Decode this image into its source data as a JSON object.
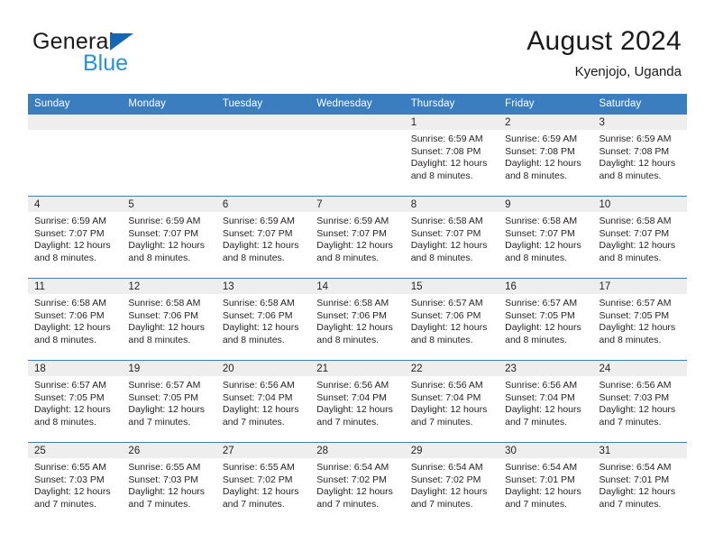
{
  "brand": {
    "name_top": "General",
    "name_bottom": "Blue",
    "flag_color": "#1667b2",
    "blue_text_color": "#2b8fd6"
  },
  "header": {
    "title": "August 2024",
    "subtitle": "Kyenjojo, Uganda",
    "accent_color": "#3a7ebf"
  },
  "weekday_headers": [
    "Sunday",
    "Monday",
    "Tuesday",
    "Wednesday",
    "Thursday",
    "Friday",
    "Saturday"
  ],
  "weeks": [
    [
      {
        "day": "",
        "empty": true
      },
      {
        "day": "",
        "empty": true
      },
      {
        "day": "",
        "empty": true
      },
      {
        "day": "",
        "empty": true
      },
      {
        "day": "1",
        "sunrise": "Sunrise: 6:59 AM",
        "sunset": "Sunset: 7:08 PM",
        "daylight1": "Daylight: 12 hours",
        "daylight2": "and 8 minutes."
      },
      {
        "day": "2",
        "sunrise": "Sunrise: 6:59 AM",
        "sunset": "Sunset: 7:08 PM",
        "daylight1": "Daylight: 12 hours",
        "daylight2": "and 8 minutes."
      },
      {
        "day": "3",
        "sunrise": "Sunrise: 6:59 AM",
        "sunset": "Sunset: 7:08 PM",
        "daylight1": "Daylight: 12 hours",
        "daylight2": "and 8 minutes."
      }
    ],
    [
      {
        "day": "4",
        "sunrise": "Sunrise: 6:59 AM",
        "sunset": "Sunset: 7:07 PM",
        "daylight1": "Daylight: 12 hours",
        "daylight2": "and 8 minutes."
      },
      {
        "day": "5",
        "sunrise": "Sunrise: 6:59 AM",
        "sunset": "Sunset: 7:07 PM",
        "daylight1": "Daylight: 12 hours",
        "daylight2": "and 8 minutes."
      },
      {
        "day": "6",
        "sunrise": "Sunrise: 6:59 AM",
        "sunset": "Sunset: 7:07 PM",
        "daylight1": "Daylight: 12 hours",
        "daylight2": "and 8 minutes."
      },
      {
        "day": "7",
        "sunrise": "Sunrise: 6:59 AM",
        "sunset": "Sunset: 7:07 PM",
        "daylight1": "Daylight: 12 hours",
        "daylight2": "and 8 minutes."
      },
      {
        "day": "8",
        "sunrise": "Sunrise: 6:58 AM",
        "sunset": "Sunset: 7:07 PM",
        "daylight1": "Daylight: 12 hours",
        "daylight2": "and 8 minutes."
      },
      {
        "day": "9",
        "sunrise": "Sunrise: 6:58 AM",
        "sunset": "Sunset: 7:07 PM",
        "daylight1": "Daylight: 12 hours",
        "daylight2": "and 8 minutes."
      },
      {
        "day": "10",
        "sunrise": "Sunrise: 6:58 AM",
        "sunset": "Sunset: 7:07 PM",
        "daylight1": "Daylight: 12 hours",
        "daylight2": "and 8 minutes."
      }
    ],
    [
      {
        "day": "11",
        "sunrise": "Sunrise: 6:58 AM",
        "sunset": "Sunset: 7:06 PM",
        "daylight1": "Daylight: 12 hours",
        "daylight2": "and 8 minutes."
      },
      {
        "day": "12",
        "sunrise": "Sunrise: 6:58 AM",
        "sunset": "Sunset: 7:06 PM",
        "daylight1": "Daylight: 12 hours",
        "daylight2": "and 8 minutes."
      },
      {
        "day": "13",
        "sunrise": "Sunrise: 6:58 AM",
        "sunset": "Sunset: 7:06 PM",
        "daylight1": "Daylight: 12 hours",
        "daylight2": "and 8 minutes."
      },
      {
        "day": "14",
        "sunrise": "Sunrise: 6:58 AM",
        "sunset": "Sunset: 7:06 PM",
        "daylight1": "Daylight: 12 hours",
        "daylight2": "and 8 minutes."
      },
      {
        "day": "15",
        "sunrise": "Sunrise: 6:57 AM",
        "sunset": "Sunset: 7:06 PM",
        "daylight1": "Daylight: 12 hours",
        "daylight2": "and 8 minutes."
      },
      {
        "day": "16",
        "sunrise": "Sunrise: 6:57 AM",
        "sunset": "Sunset: 7:05 PM",
        "daylight1": "Daylight: 12 hours",
        "daylight2": "and 8 minutes."
      },
      {
        "day": "17",
        "sunrise": "Sunrise: 6:57 AM",
        "sunset": "Sunset: 7:05 PM",
        "daylight1": "Daylight: 12 hours",
        "daylight2": "and 8 minutes."
      }
    ],
    [
      {
        "day": "18",
        "sunrise": "Sunrise: 6:57 AM",
        "sunset": "Sunset: 7:05 PM",
        "daylight1": "Daylight: 12 hours",
        "daylight2": "and 8 minutes."
      },
      {
        "day": "19",
        "sunrise": "Sunrise: 6:57 AM",
        "sunset": "Sunset: 7:05 PM",
        "daylight1": "Daylight: 12 hours",
        "daylight2": "and 7 minutes."
      },
      {
        "day": "20",
        "sunrise": "Sunrise: 6:56 AM",
        "sunset": "Sunset: 7:04 PM",
        "daylight1": "Daylight: 12 hours",
        "daylight2": "and 7 minutes."
      },
      {
        "day": "21",
        "sunrise": "Sunrise: 6:56 AM",
        "sunset": "Sunset: 7:04 PM",
        "daylight1": "Daylight: 12 hours",
        "daylight2": "and 7 minutes."
      },
      {
        "day": "22",
        "sunrise": "Sunrise: 6:56 AM",
        "sunset": "Sunset: 7:04 PM",
        "daylight1": "Daylight: 12 hours",
        "daylight2": "and 7 minutes."
      },
      {
        "day": "23",
        "sunrise": "Sunrise: 6:56 AM",
        "sunset": "Sunset: 7:04 PM",
        "daylight1": "Daylight: 12 hours",
        "daylight2": "and 7 minutes."
      },
      {
        "day": "24",
        "sunrise": "Sunrise: 6:56 AM",
        "sunset": "Sunset: 7:03 PM",
        "daylight1": "Daylight: 12 hours",
        "daylight2": "and 7 minutes."
      }
    ],
    [
      {
        "day": "25",
        "sunrise": "Sunrise: 6:55 AM",
        "sunset": "Sunset: 7:03 PM",
        "daylight1": "Daylight: 12 hours",
        "daylight2": "and 7 minutes."
      },
      {
        "day": "26",
        "sunrise": "Sunrise: 6:55 AM",
        "sunset": "Sunset: 7:03 PM",
        "daylight1": "Daylight: 12 hours",
        "daylight2": "and 7 minutes."
      },
      {
        "day": "27",
        "sunrise": "Sunrise: 6:55 AM",
        "sunset": "Sunset: 7:02 PM",
        "daylight1": "Daylight: 12 hours",
        "daylight2": "and 7 minutes."
      },
      {
        "day": "28",
        "sunrise": "Sunrise: 6:54 AM",
        "sunset": "Sunset: 7:02 PM",
        "daylight1": "Daylight: 12 hours",
        "daylight2": "and 7 minutes."
      },
      {
        "day": "29",
        "sunrise": "Sunrise: 6:54 AM",
        "sunset": "Sunset: 7:02 PM",
        "daylight1": "Daylight: 12 hours",
        "daylight2": "and 7 minutes."
      },
      {
        "day": "30",
        "sunrise": "Sunrise: 6:54 AM",
        "sunset": "Sunset: 7:01 PM",
        "daylight1": "Daylight: 12 hours",
        "daylight2": "and 7 minutes."
      },
      {
        "day": "31",
        "sunrise": "Sunrise: 6:54 AM",
        "sunset": "Sunset: 7:01 PM",
        "daylight1": "Daylight: 12 hours",
        "daylight2": "and 7 minutes."
      }
    ]
  ]
}
